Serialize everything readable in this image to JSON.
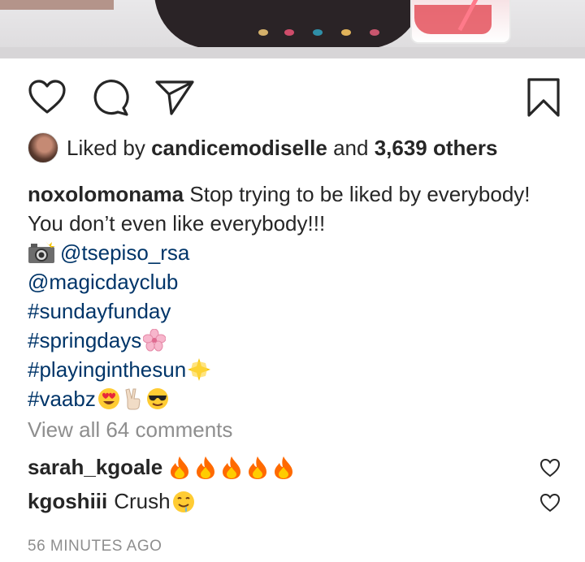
{
  "post": {
    "likes": {
      "prefix": "Liked by",
      "user": "candicemodiselle",
      "and": "and",
      "count": "3,639 others"
    },
    "caption": {
      "username": "noxolomonama",
      "line1": "Stop trying to be liked by everybody!",
      "line2": "You don’t even like everybody!!!",
      "mention1": "@tsepiso_rsa",
      "mention2": "@magicdayclub",
      "tag1": "#sundayfunday",
      "tag2": "#springdays",
      "tag3": "#playinginthesun",
      "tag4": "#vaabz"
    },
    "view_all_comments": "View all 64 comments",
    "comments": [
      {
        "user": "sarah_kgoale",
        "text": ""
      },
      {
        "user": "kgoshiii",
        "text": "Crush"
      }
    ],
    "timestamp": "56 MINUTES AGO"
  },
  "icons": {
    "like": "heart-icon",
    "comment": "comment-bubble-icon",
    "share": "paper-plane-icon",
    "save": "bookmark-icon"
  },
  "colors": {
    "text": "#262626",
    "link": "#003569",
    "muted": "#8e8e8e",
    "fire": "#ff6a00"
  }
}
